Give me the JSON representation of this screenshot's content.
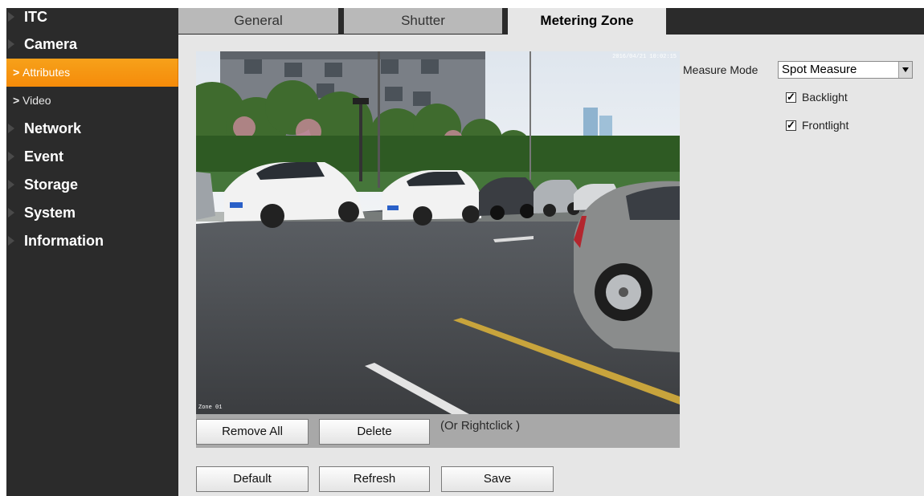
{
  "sidebar": {
    "items": [
      {
        "label": "ITC",
        "type": "top"
      },
      {
        "label": "Camera",
        "type": "top"
      },
      {
        "label": "Attributes",
        "type": "sub",
        "active": true
      },
      {
        "label": "Video",
        "type": "sub"
      },
      {
        "label": "Network",
        "type": "top"
      },
      {
        "label": "Event",
        "type": "top"
      },
      {
        "label": "Storage",
        "type": "top"
      },
      {
        "label": "System",
        "type": "top"
      },
      {
        "label": "Information",
        "type": "top"
      }
    ]
  },
  "tabs": [
    {
      "label": "General"
    },
    {
      "label": "Shutter"
    },
    {
      "label": "Metering Zone",
      "active": true
    }
  ],
  "video": {
    "osd_top_right": "2016/04/21 10:02:15",
    "osd_bottom_left": "Zone 01"
  },
  "toolbar": {
    "remove_all_label": "Remove All",
    "delete_label": "Delete",
    "hint": "(Or Rightclick )"
  },
  "settings": {
    "measure_mode_label": "Measure Mode",
    "measure_mode_value": "Spot Measure",
    "backlight_label": "Backlight",
    "backlight_checked": true,
    "frontlight_label": "Frontlight",
    "frontlight_checked": true
  },
  "footer": {
    "default_label": "Default",
    "refresh_label": "Refresh",
    "save_label": "Save"
  },
  "colors": {
    "sidebar_bg": "#2b2b2b",
    "accent_active": "#f7a11a",
    "panel_bg": "#e6e6e6"
  }
}
